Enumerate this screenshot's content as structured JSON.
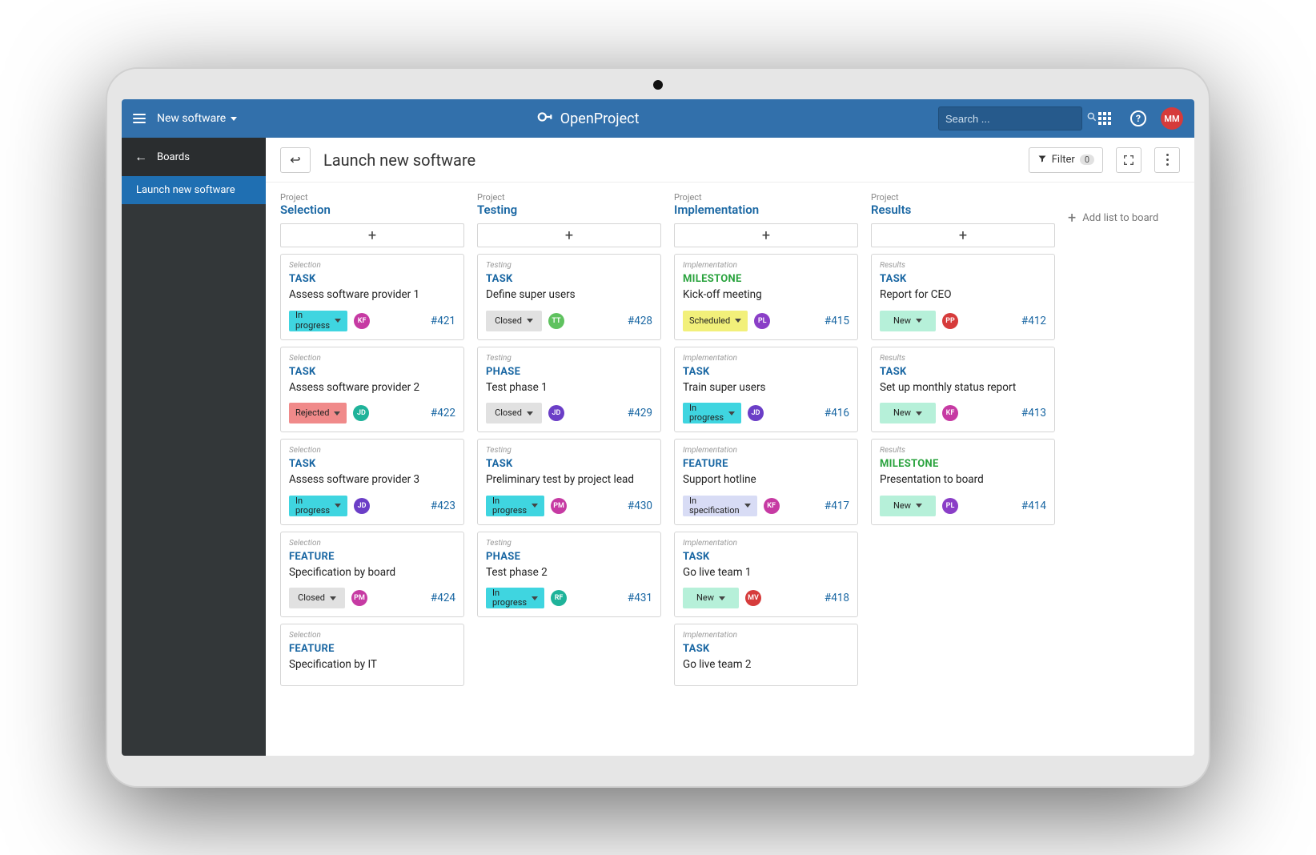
{
  "topbar": {
    "project": "New software",
    "brand": "OpenProject",
    "search_placeholder": "Search ...",
    "avatar": "MM"
  },
  "sidebar": {
    "back_label": "Boards",
    "items": [
      {
        "label": "Launch new software",
        "active": true
      }
    ]
  },
  "toolbar": {
    "title": "Launch new software",
    "filter_label": "Filter",
    "filter_count": "0"
  },
  "board": {
    "list_sup": "Project",
    "add_list_label": "Add list to board",
    "lists": [
      {
        "name": "Selection",
        "cards": [
          {
            "crumb": "Selection",
            "type": "TASK",
            "title": "Assess software provider 1",
            "status": "In progress",
            "status_key": "inprogress",
            "avatar": "KF",
            "avatar_color": "#c63aa3",
            "id": "#421"
          },
          {
            "crumb": "Selection",
            "type": "TASK",
            "title": "Assess software provider 2",
            "status": "Rejected",
            "status_key": "rejected",
            "avatar": "JD",
            "avatar_color": "#1fb39a",
            "id": "#422"
          },
          {
            "crumb": "Selection",
            "type": "TASK",
            "title": "Assess software provider 3",
            "status": "In progress",
            "status_key": "inprogress",
            "avatar": "JD",
            "avatar_color": "#6b3ec7",
            "id": "#423"
          },
          {
            "crumb": "Selection",
            "type": "FEATURE",
            "title": "Specification by board",
            "status": "Closed",
            "status_key": "closed",
            "avatar": "PM",
            "avatar_color": "#c63aa3",
            "id": "#424"
          },
          {
            "crumb": "Selection",
            "type": "FEATURE",
            "title": "Specification by IT",
            "status": "",
            "status_key": "",
            "avatar": "",
            "avatar_color": "",
            "id": ""
          }
        ]
      },
      {
        "name": "Testing",
        "cards": [
          {
            "crumb": "Testing",
            "type": "TASK",
            "title": "Define super users",
            "status": "Closed",
            "status_key": "closed",
            "avatar": "TT",
            "avatar_color": "#5fc25f",
            "id": "#428"
          },
          {
            "crumb": "Testing",
            "type": "PHASE",
            "title": "Test phase 1",
            "status": "Closed",
            "status_key": "closed",
            "avatar": "JD",
            "avatar_color": "#6b3ec7",
            "id": "#429"
          },
          {
            "crumb": "Testing",
            "type": "TASK",
            "title": "Preliminary test by project lead",
            "status": "In progress",
            "status_key": "inprogress",
            "avatar": "PM",
            "avatar_color": "#c63aa3",
            "id": "#430"
          },
          {
            "crumb": "Testing",
            "type": "PHASE",
            "title": "Test phase 2",
            "status": "In progress",
            "status_key": "inprogress",
            "avatar": "RF",
            "avatar_color": "#1fb39a",
            "id": "#431"
          }
        ]
      },
      {
        "name": "Implementation",
        "cards": [
          {
            "crumb": "Implementation",
            "type": "MILESTONE",
            "title": "Kick-off meeting",
            "status": "Scheduled",
            "status_key": "scheduled",
            "avatar": "PL",
            "avatar_color": "#8a3ec7",
            "id": "#415"
          },
          {
            "crumb": "Implementation",
            "type": "TASK",
            "title": "Train super users",
            "status": "In progress",
            "status_key": "inprogress",
            "avatar": "JD",
            "avatar_color": "#6b3ec7",
            "id": "#416"
          },
          {
            "crumb": "Implementation",
            "type": "FEATURE",
            "title": "Support hotline",
            "status": "In specification",
            "status_key": "inspecification",
            "avatar": "KF",
            "avatar_color": "#c63aa3",
            "id": "#417"
          },
          {
            "crumb": "Implementation",
            "type": "TASK",
            "title": "Go live team 1",
            "status": "New",
            "status_key": "new",
            "avatar": "MV",
            "avatar_color": "#d63b3b",
            "id": "#418"
          },
          {
            "crumb": "Implementation",
            "type": "TASK",
            "title": "Go live team 2",
            "status": "",
            "status_key": "",
            "avatar": "",
            "avatar_color": "",
            "id": ""
          }
        ]
      },
      {
        "name": "Results",
        "cards": [
          {
            "crumb": "Results",
            "type": "TASK",
            "title": "Report for CEO",
            "status": "New",
            "status_key": "new",
            "avatar": "PP",
            "avatar_color": "#d63b3b",
            "id": "#412"
          },
          {
            "crumb": "Results",
            "type": "TASK",
            "title": "Set up monthly status report",
            "status": "New",
            "status_key": "new",
            "avatar": "KF",
            "avatar_color": "#c63aa3",
            "id": "#413"
          },
          {
            "crumb": "Results",
            "type": "MILESTONE",
            "title": "Presentation to board",
            "status": "New",
            "status_key": "new",
            "avatar": "PL",
            "avatar_color": "#8a3ec7",
            "id": "#414"
          }
        ]
      }
    ]
  }
}
